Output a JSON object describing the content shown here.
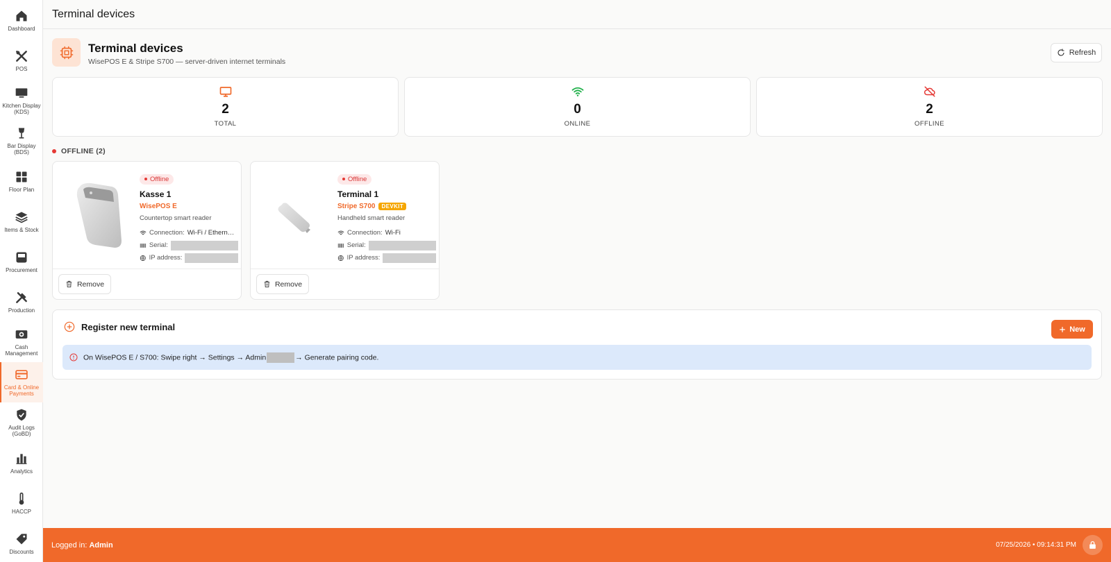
{
  "sidebar": {
    "items": [
      {
        "label": "Dashboard",
        "icon": "home-icon"
      },
      {
        "label": "POS",
        "icon": "utensils-icon"
      },
      {
        "label": "Kitchen Display (KDS)",
        "icon": "monitor-icon"
      },
      {
        "label": "Bar Display (BDS)",
        "icon": "wine-glass-icon"
      },
      {
        "label": "Floor Plan",
        "icon": "grid-icon"
      },
      {
        "label": "Items & Stock",
        "icon": "layers-icon"
      },
      {
        "label": "Procurement",
        "icon": "inbox-icon"
      },
      {
        "label": "Production",
        "icon": "tools-icon"
      },
      {
        "label": "Cash Management",
        "icon": "cash-icon"
      },
      {
        "label": "Card & Online Payments",
        "icon": "credit-card-icon"
      },
      {
        "label": "Audit Logs (GoBD)",
        "icon": "shield-check-icon"
      },
      {
        "label": "Analytics",
        "icon": "bar-chart-icon"
      },
      {
        "label": "HACCP",
        "icon": "thermometer-icon"
      },
      {
        "label": "Discounts",
        "icon": "tag-icon"
      }
    ],
    "active": "Card & Online Payments"
  },
  "topbar": {
    "title": "Terminal devices"
  },
  "header": {
    "title": "Terminal devices",
    "subtitle": "WisePOS E & Stripe S700 — server-driven internet terminals",
    "refresh_label": "Refresh"
  },
  "stats": [
    {
      "value": "2",
      "label": "TOTAL",
      "icon": "monitor-icon",
      "color": "#f0692a"
    },
    {
      "value": "0",
      "label": "ONLINE",
      "icon": "wifi-icon",
      "color": "#22b14c"
    },
    {
      "value": "2",
      "label": "OFFLINE",
      "icon": "cloud-off-icon",
      "color": "#e53935"
    }
  ],
  "offline_section": {
    "label": "OFFLINE (2)"
  },
  "devices": [
    {
      "status": "Offline",
      "name": "Kasse 1",
      "model": "WisePOS E",
      "tag": "",
      "description": "Countertop smart reader",
      "connection_label": "Connection:",
      "connection": "Wi-Fi / Ethern…",
      "serial_label": "Serial:",
      "ip_label": "IP address:",
      "remove_label": "Remove"
    },
    {
      "status": "Offline",
      "name": "Terminal 1",
      "model": "Stripe S700",
      "tag": "DEVKIT",
      "description": "Handheld smart reader",
      "connection_label": "Connection:",
      "connection": "Wi-Fi",
      "serial_label": "Serial:",
      "ip_label": "IP address:",
      "remove_label": "Remove"
    }
  ],
  "register": {
    "title": "Register new terminal",
    "new_label": "New",
    "info_before": "On WisePOS E / S700: Swipe right → Settings → Admin",
    "info_after": "→ Generate pairing code."
  },
  "footer": {
    "logged_in_label": "Logged in:",
    "user": "Admin",
    "datetime": "07/25/2026 • 09:14:31 PM"
  },
  "colors": {
    "accent": "#f0692a",
    "online": "#22b14c",
    "offline": "#e53935",
    "info_bg": "#dce9fb"
  }
}
